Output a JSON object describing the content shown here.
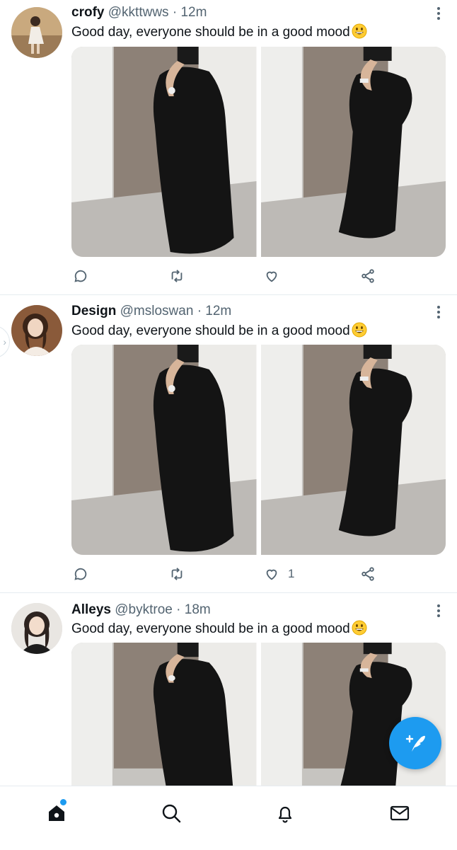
{
  "colors": {
    "accent": "#1d9bf0",
    "text": "#0f1419",
    "secondary": "#536471",
    "divider": "#e6ecf0"
  },
  "tweets": [
    {
      "name": "crofy",
      "handle": "@kkttwws",
      "dot": "·",
      "time": "12m",
      "text": "Good day, everyone should be in a good mood",
      "emoji": "grinning-face-emoji",
      "like_count": ""
    },
    {
      "name": "Design",
      "handle": "@msloswan",
      "dot": "·",
      "time": "12m",
      "text": "Good day, everyone should be in a good mood",
      "emoji": "grinning-face-emoji",
      "like_count": "1"
    },
    {
      "name": "Alleys",
      "handle": "@byktroe",
      "dot": "·",
      "time": "18m",
      "text": "Good day, everyone should be in a good mood",
      "emoji": "grinning-face-emoji",
      "like_count": ""
    }
  ],
  "icons": {
    "actions": [
      "reply-icon",
      "retweet-icon",
      "like-icon",
      "share-icon"
    ],
    "tabs": [
      "home-icon",
      "search-icon",
      "notifications-icon",
      "messages-icon"
    ],
    "fab": "compose-tweet-icon"
  }
}
